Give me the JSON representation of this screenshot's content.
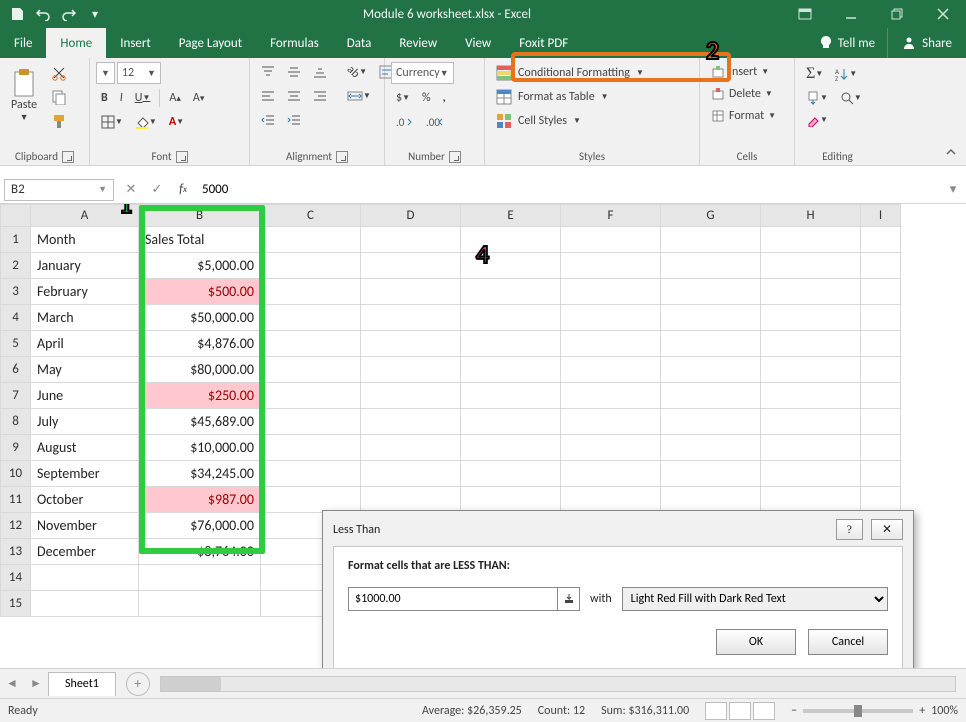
{
  "title": "Module 6 worksheet.xlsx - Excel",
  "qa_icons": [
    "save-icon",
    "undo-icon",
    "redo-icon",
    "customize-icon"
  ],
  "win_icons": [
    "ribbon-opts-icon",
    "minimize-icon",
    "restore-icon",
    "close-icon"
  ],
  "tabs": [
    "File",
    "Home",
    "Insert",
    "Page Layout",
    "Formulas",
    "Data",
    "Review",
    "View",
    "Foxit PDF"
  ],
  "active_tab": "Home",
  "tellme": "Tell me",
  "share": "Share",
  "ribbon": {
    "clipboard": {
      "label": "Clipboard",
      "paste": "Paste"
    },
    "font": {
      "label": "Font",
      "name": "",
      "size": "12"
    },
    "alignment": {
      "label": "Alignment"
    },
    "number": {
      "label": "Number",
      "format": "Currency"
    },
    "styles": {
      "label": "Styles",
      "cf": "Conditional Formatting",
      "fat": "Format as Table",
      "cs": "Cell Styles"
    },
    "cells": {
      "label": "Cells",
      "insert": "Insert",
      "delete": "Delete",
      "format": "Format"
    },
    "editing": {
      "label": "Editing"
    }
  },
  "namebox": "B2",
  "formula": "5000",
  "columns": [
    "A",
    "B",
    "C",
    "D",
    "E",
    "F",
    "G",
    "H",
    "I"
  ],
  "headerRow": {
    "A": "Month",
    "B": "Sales Total"
  },
  "rows": [
    {
      "n": 1,
      "A": "Month",
      "B": "Sales Total",
      "red": false,
      "header": true
    },
    {
      "n": 2,
      "A": "January",
      "B": "$5,000.00",
      "red": false
    },
    {
      "n": 3,
      "A": "February",
      "B": "$500.00",
      "red": true
    },
    {
      "n": 4,
      "A": "March",
      "B": "$50,000.00",
      "red": false
    },
    {
      "n": 5,
      "A": "April",
      "B": "$4,876.00",
      "red": false
    },
    {
      "n": 6,
      "A": "May",
      "B": "$80,000.00",
      "red": false
    },
    {
      "n": 7,
      "A": "June",
      "B": "$250.00",
      "red": true
    },
    {
      "n": 8,
      "A": "July",
      "B": "$45,689.00",
      "red": false
    },
    {
      "n": 9,
      "A": "August",
      "B": "$10,000.00",
      "red": false
    },
    {
      "n": 10,
      "A": "September",
      "B": "$34,245.00",
      "red": false
    },
    {
      "n": 11,
      "A": "October",
      "B": "$987.00",
      "red": true
    },
    {
      "n": 12,
      "A": "November",
      "B": "$76,000.00",
      "red": false
    },
    {
      "n": 13,
      "A": "December",
      "B": "$8,764.00",
      "red": false
    },
    {
      "n": 14,
      "A": "",
      "B": "",
      "red": false
    },
    {
      "n": 15,
      "A": "",
      "B": "",
      "red": false
    }
  ],
  "dialog": {
    "title": "Less Than",
    "header": "Format cells that are LESS THAN:",
    "value": "$1000.00",
    "with": "with",
    "format_option": "Light Red Fill with Dark Red Text",
    "ok": "OK",
    "cancel": "Cancel"
  },
  "annotations": {
    "one": "1",
    "two": "2",
    "four": "4"
  },
  "sheettab": "Sheet1",
  "status": {
    "ready": "Ready",
    "avg": "Average: $26,359.25",
    "count": "Count: 12",
    "sum": "Sum: $316,311.00",
    "zoom": "100%"
  }
}
